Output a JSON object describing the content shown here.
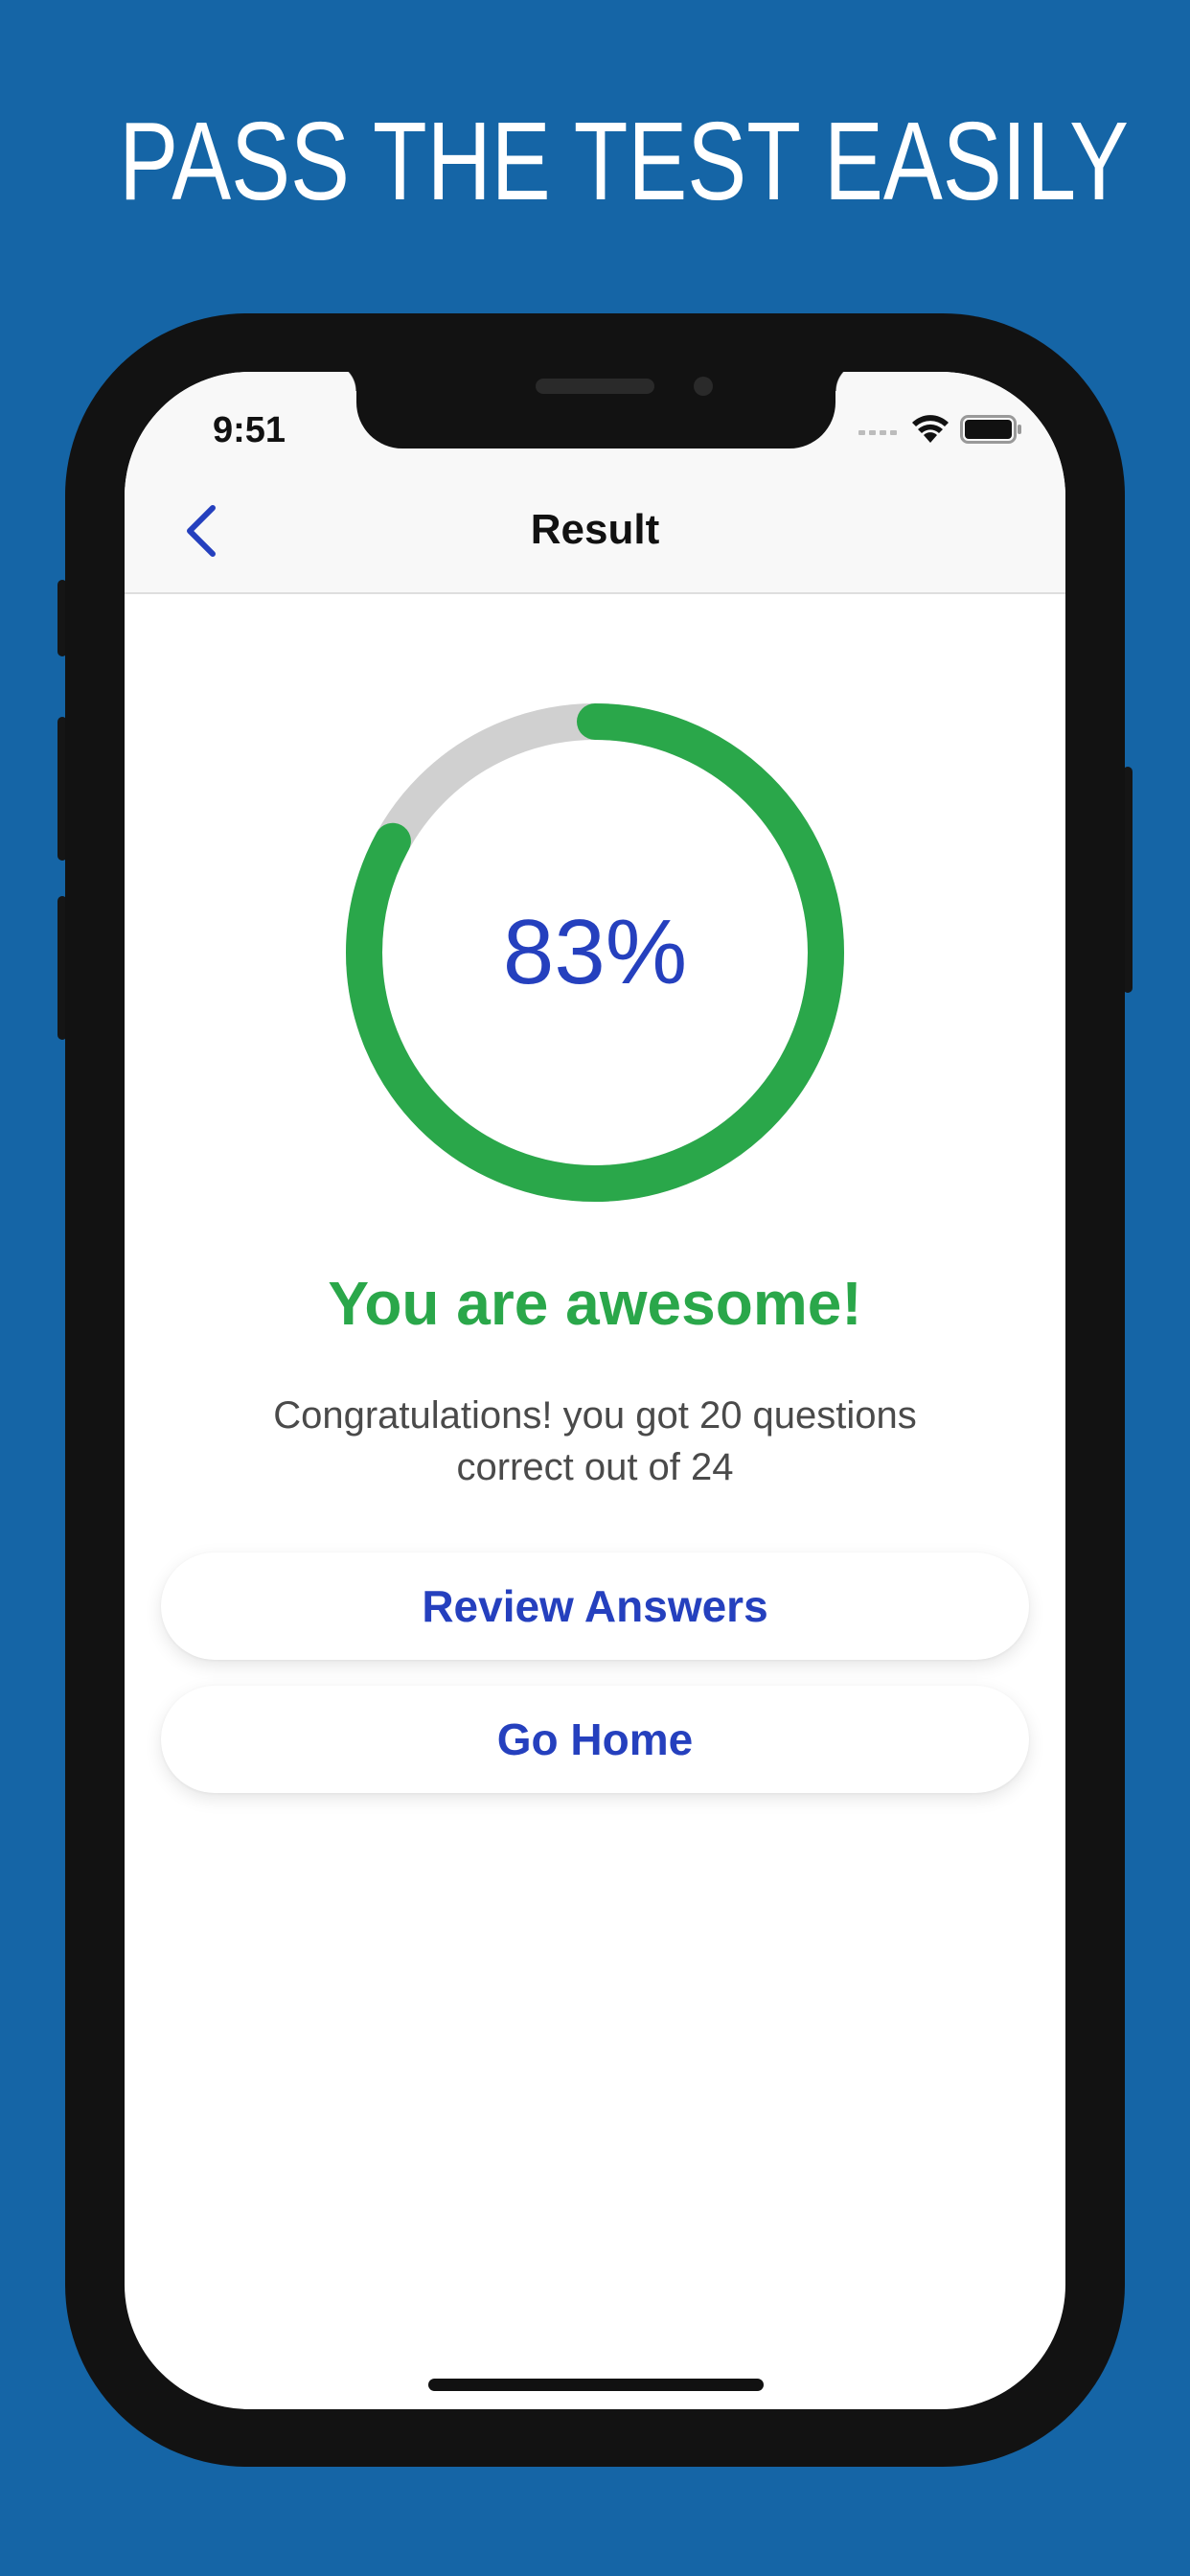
{
  "headline": "PASS THE TEST EASILY",
  "status_bar": {
    "time": "9:51",
    "icons": [
      "signal-icon",
      "wifi-icon",
      "battery-icon"
    ]
  },
  "navbar": {
    "title": "Result",
    "back_icon": "chevron-left-icon"
  },
  "result": {
    "percent_label": "83%",
    "percent_value": 83,
    "message": "You are awesome!",
    "summary": "Congratulations! you got 20 questions correct out of 24"
  },
  "buttons": {
    "review_label": "Review Answers",
    "home_label": "Go Home"
  },
  "colors": {
    "background": "#1565a6",
    "accent_blue": "#2540be",
    "success_green": "#2aa74a",
    "track_gray": "#d0d0d0"
  }
}
